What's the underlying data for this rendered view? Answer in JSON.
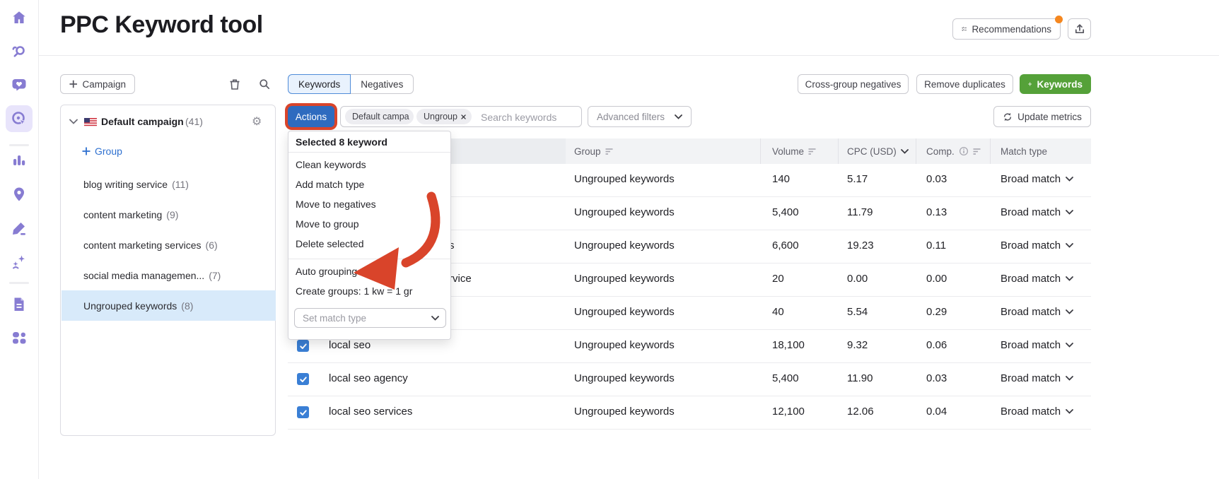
{
  "app": {
    "title": "PPC Keyword tool"
  },
  "header": {
    "recommendations_label": "Recommendations",
    "badge_color": "#f5871f"
  },
  "toolbar": {
    "campaign_label": "Campaign",
    "tabs": {
      "keywords": "Keywords",
      "negatives": "Negatives"
    },
    "cross_group_label": "Cross-group negatives",
    "remove_duplicates_label": "Remove duplicates",
    "add_keywords_label": "Keywords",
    "update_metrics_label": "Update metrics"
  },
  "filter_bar": {
    "actions_label": "Actions",
    "chips": [
      {
        "label": "Default campa"
      },
      {
        "label": "Ungroup",
        "closable": true
      }
    ],
    "search_placeholder": "Search keywords",
    "advanced_filters_label": "Advanced filters"
  },
  "campaign_tree": {
    "campaign_name": "Default campaign",
    "campaign_count": "(41)",
    "add_group_label": "Group",
    "groups": [
      {
        "name": "blog writing service",
        "count": "(11)",
        "selected": false
      },
      {
        "name": "content marketing",
        "count": "(9)",
        "selected": false
      },
      {
        "name": "content marketing services",
        "count": "(6)",
        "selected": false
      },
      {
        "name": "social media managemen...",
        "count": "(7)",
        "selected": false
      },
      {
        "name": "Ungrouped keywords",
        "count": "(8)",
        "selected": true
      }
    ]
  },
  "actions_menu": {
    "header": "Selected 8 keyword",
    "group1": [
      "Clean keywords",
      "Add match type",
      "Move to negatives",
      "Move to group",
      "Delete selected"
    ],
    "group2": [
      "Auto grouping",
      "Create groups: 1 kw = 1 gr"
    ],
    "set_match_type_placeholder": "Set match type"
  },
  "table": {
    "columns": {
      "group": "Group",
      "volume": "Volume",
      "cpc": "CPC (USD)",
      "comp": "Comp.",
      "match_type": "Match type"
    },
    "rows": [
      {
        "keyword": "",
        "fragment": true,
        "group": "Ungrouped keywords",
        "volume": "140",
        "cpc": "5.17",
        "comp": "0.03",
        "match_type": "Broad match",
        "checked": true
      },
      {
        "keyword": "",
        "fragment": true,
        "group": "Ungrouped keywords",
        "volume": "5,400",
        "cpc": "11.79",
        "comp": "0.13",
        "match_type": "Broad match",
        "checked": true
      },
      {
        "keyword": "s",
        "fragment": true,
        "group": "Ungrouped keywords",
        "volume": "6,600",
        "cpc": "19.23",
        "comp": "0.11",
        "match_type": "Broad match",
        "checked": true
      },
      {
        "keyword": "rvice",
        "fragment": true,
        "group": "Ungrouped keywords",
        "volume": "20",
        "cpc": "0.00",
        "comp": "0.00",
        "match_type": "Broad match",
        "checked": true
      },
      {
        "keyword": "",
        "fragment": true,
        "group": "Ungrouped keywords",
        "volume": "40",
        "cpc": "5.54",
        "comp": "0.29",
        "match_type": "Broad match",
        "checked": true
      },
      {
        "keyword": "local seo",
        "fragment": false,
        "group": "Ungrouped keywords",
        "volume": "18,100",
        "cpc": "9.32",
        "comp": "0.06",
        "match_type": "Broad match",
        "checked": true
      },
      {
        "keyword": "local seo agency",
        "fragment": false,
        "group": "Ungrouped keywords",
        "volume": "5,400",
        "cpc": "11.90",
        "comp": "0.03",
        "match_type": "Broad match",
        "checked": true
      },
      {
        "keyword": "local seo services",
        "fragment": false,
        "group": "Ungrouped keywords",
        "volume": "12,100",
        "cpc": "12.06",
        "comp": "0.04",
        "match_type": "Broad match",
        "checked": true
      }
    ]
  },
  "sidebar": {
    "icons": [
      "home",
      "keyword-research",
      "feedback",
      "ppc-keyword-tool",
      "analytics",
      "local-listings",
      "content-tools",
      "ai-tools",
      "reports",
      "more-tools"
    ],
    "active_icon": "ppc-keyword-tool"
  },
  "colors": {
    "accent_blue": "#2e6bbf",
    "green": "#55a139",
    "annotation_red": "#d9442a",
    "sidebar_purple": "#877cd2",
    "badge_orange": "#f5871f",
    "selected_row_bg": "#d8eafa",
    "tab_selected_bg": "#e9f2fd",
    "checkbox_blue": "#3a7fd5"
  }
}
